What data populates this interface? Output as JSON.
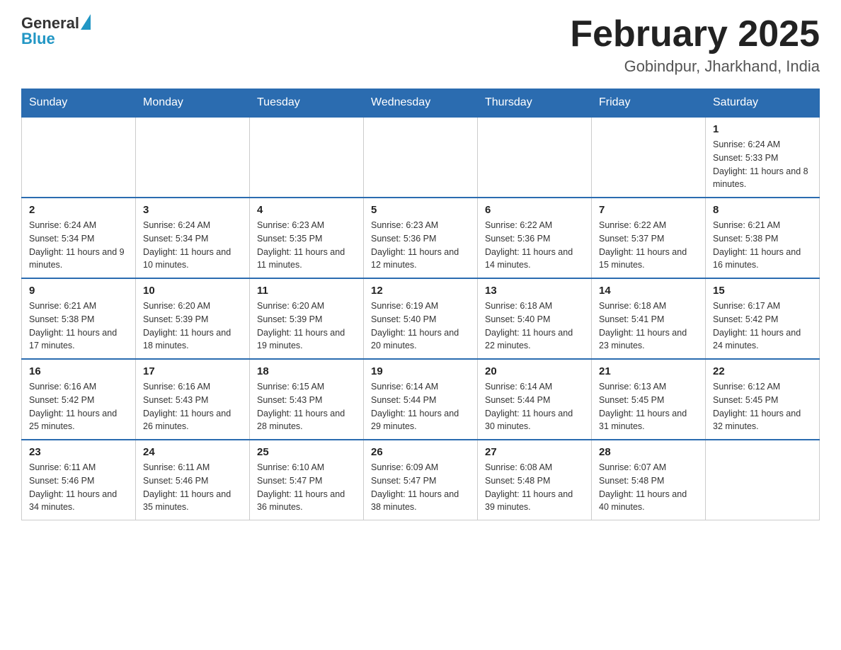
{
  "header": {
    "logo_general": "General",
    "logo_blue": "Blue",
    "month_title": "February 2025",
    "location": "Gobindpur, Jharkhand, India"
  },
  "weekdays": [
    "Sunday",
    "Monday",
    "Tuesday",
    "Wednesday",
    "Thursday",
    "Friday",
    "Saturday"
  ],
  "weeks": [
    [
      {
        "day": "",
        "info": ""
      },
      {
        "day": "",
        "info": ""
      },
      {
        "day": "",
        "info": ""
      },
      {
        "day": "",
        "info": ""
      },
      {
        "day": "",
        "info": ""
      },
      {
        "day": "",
        "info": ""
      },
      {
        "day": "1",
        "info": "Sunrise: 6:24 AM\nSunset: 5:33 PM\nDaylight: 11 hours\nand 8 minutes."
      }
    ],
    [
      {
        "day": "2",
        "info": "Sunrise: 6:24 AM\nSunset: 5:34 PM\nDaylight: 11 hours\nand 9 minutes."
      },
      {
        "day": "3",
        "info": "Sunrise: 6:24 AM\nSunset: 5:34 PM\nDaylight: 11 hours\nand 10 minutes."
      },
      {
        "day": "4",
        "info": "Sunrise: 6:23 AM\nSunset: 5:35 PM\nDaylight: 11 hours\nand 11 minutes."
      },
      {
        "day": "5",
        "info": "Sunrise: 6:23 AM\nSunset: 5:36 PM\nDaylight: 11 hours\nand 12 minutes."
      },
      {
        "day": "6",
        "info": "Sunrise: 6:22 AM\nSunset: 5:36 PM\nDaylight: 11 hours\nand 14 minutes."
      },
      {
        "day": "7",
        "info": "Sunrise: 6:22 AM\nSunset: 5:37 PM\nDaylight: 11 hours\nand 15 minutes."
      },
      {
        "day": "8",
        "info": "Sunrise: 6:21 AM\nSunset: 5:38 PM\nDaylight: 11 hours\nand 16 minutes."
      }
    ],
    [
      {
        "day": "9",
        "info": "Sunrise: 6:21 AM\nSunset: 5:38 PM\nDaylight: 11 hours\nand 17 minutes."
      },
      {
        "day": "10",
        "info": "Sunrise: 6:20 AM\nSunset: 5:39 PM\nDaylight: 11 hours\nand 18 minutes."
      },
      {
        "day": "11",
        "info": "Sunrise: 6:20 AM\nSunset: 5:39 PM\nDaylight: 11 hours\nand 19 minutes."
      },
      {
        "day": "12",
        "info": "Sunrise: 6:19 AM\nSunset: 5:40 PM\nDaylight: 11 hours\nand 20 minutes."
      },
      {
        "day": "13",
        "info": "Sunrise: 6:18 AM\nSunset: 5:40 PM\nDaylight: 11 hours\nand 22 minutes."
      },
      {
        "day": "14",
        "info": "Sunrise: 6:18 AM\nSunset: 5:41 PM\nDaylight: 11 hours\nand 23 minutes."
      },
      {
        "day": "15",
        "info": "Sunrise: 6:17 AM\nSunset: 5:42 PM\nDaylight: 11 hours\nand 24 minutes."
      }
    ],
    [
      {
        "day": "16",
        "info": "Sunrise: 6:16 AM\nSunset: 5:42 PM\nDaylight: 11 hours\nand 25 minutes."
      },
      {
        "day": "17",
        "info": "Sunrise: 6:16 AM\nSunset: 5:43 PM\nDaylight: 11 hours\nand 26 minutes."
      },
      {
        "day": "18",
        "info": "Sunrise: 6:15 AM\nSunset: 5:43 PM\nDaylight: 11 hours\nand 28 minutes."
      },
      {
        "day": "19",
        "info": "Sunrise: 6:14 AM\nSunset: 5:44 PM\nDaylight: 11 hours\nand 29 minutes."
      },
      {
        "day": "20",
        "info": "Sunrise: 6:14 AM\nSunset: 5:44 PM\nDaylight: 11 hours\nand 30 minutes."
      },
      {
        "day": "21",
        "info": "Sunrise: 6:13 AM\nSunset: 5:45 PM\nDaylight: 11 hours\nand 31 minutes."
      },
      {
        "day": "22",
        "info": "Sunrise: 6:12 AM\nSunset: 5:45 PM\nDaylight: 11 hours\nand 32 minutes."
      }
    ],
    [
      {
        "day": "23",
        "info": "Sunrise: 6:11 AM\nSunset: 5:46 PM\nDaylight: 11 hours\nand 34 minutes."
      },
      {
        "day": "24",
        "info": "Sunrise: 6:11 AM\nSunset: 5:46 PM\nDaylight: 11 hours\nand 35 minutes."
      },
      {
        "day": "25",
        "info": "Sunrise: 6:10 AM\nSunset: 5:47 PM\nDaylight: 11 hours\nand 36 minutes."
      },
      {
        "day": "26",
        "info": "Sunrise: 6:09 AM\nSunset: 5:47 PM\nDaylight: 11 hours\nand 38 minutes."
      },
      {
        "day": "27",
        "info": "Sunrise: 6:08 AM\nSunset: 5:48 PM\nDaylight: 11 hours\nand 39 minutes."
      },
      {
        "day": "28",
        "info": "Sunrise: 6:07 AM\nSunset: 5:48 PM\nDaylight: 11 hours\nand 40 minutes."
      },
      {
        "day": "",
        "info": ""
      }
    ]
  ]
}
